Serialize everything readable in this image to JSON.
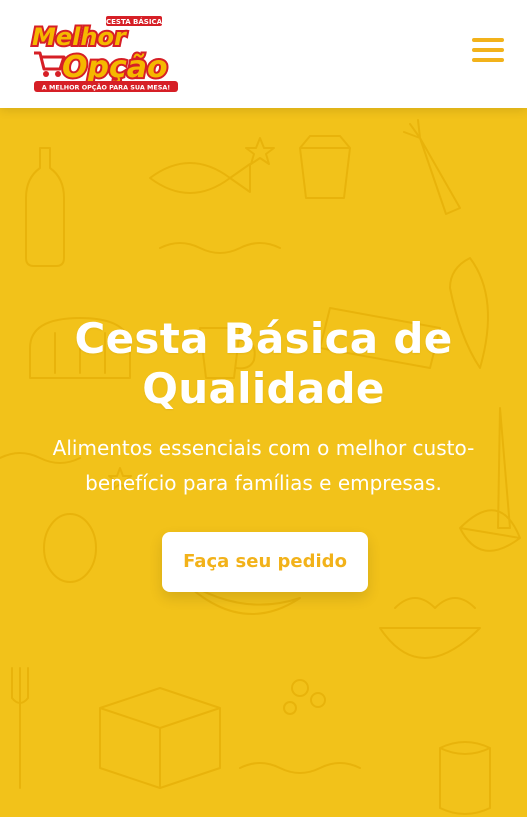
{
  "header": {
    "logo": {
      "top_text": "CESTA BÁSICA",
      "line1": "Melhor",
      "line2": "Opção",
      "tagline": "A MELHOR OPÇÃO PARA SUA MESA!"
    },
    "menu_icon": "hamburger-menu-icon"
  },
  "hero": {
    "title": "Cesta Básica de Qualidade",
    "subtitle": "Alimentos essenciais com o melhor custo-benefício para famílias e empresas.",
    "cta_label": "Faça seu pedido"
  },
  "colors": {
    "brand_yellow": "#f2c21a",
    "accent_yellow": "#f2b21a",
    "logo_red": "#d61f26",
    "white": "#ffffff"
  }
}
